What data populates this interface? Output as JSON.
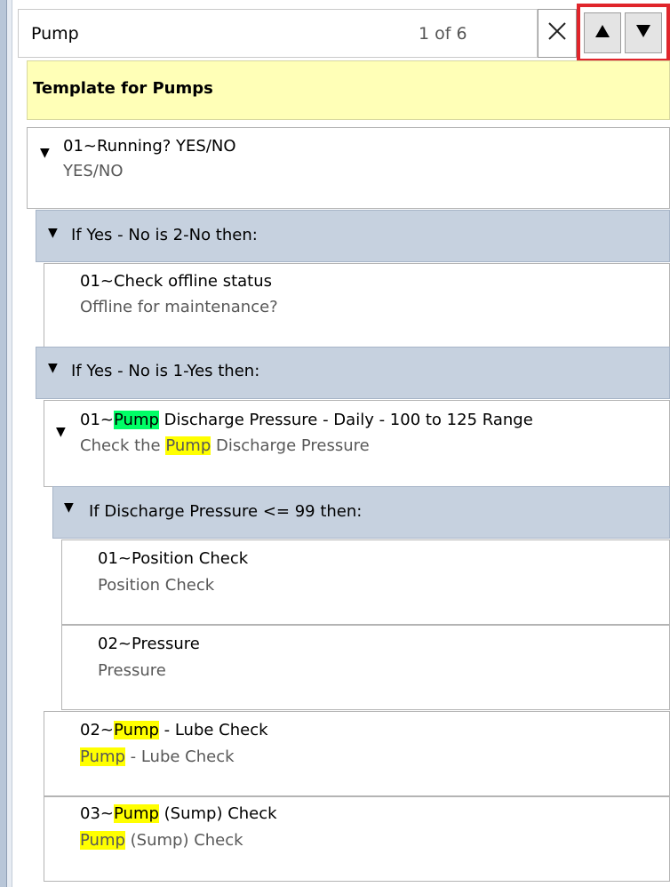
{
  "search": {
    "query": "Pump",
    "match_count": "1 of 6",
    "clear_icon": "close-icon",
    "prev_icon": "triangle-up-icon",
    "next_icon": "triangle-down-icon"
  },
  "template": {
    "title": "Template for Pumps"
  },
  "nodes": {
    "running": {
      "title": "01~Running? YES/NO",
      "subtitle": "YES/NO"
    },
    "cond_no": {
      "label": "If Yes - No is 2-No then:"
    },
    "offline": {
      "title": "01~Check offline status",
      "subtitle": "Offline for maintenance?"
    },
    "cond_yes": {
      "label": "If Yes - No is 1-Yes then:"
    },
    "discharge": {
      "title_prefix": "01~",
      "title_match": "Pump",
      "title_rest": " Discharge Pressure - Daily - 100 to 125 Range",
      "sub_prefix": "Check the ",
      "sub_match": "Pump",
      "sub_rest": " Discharge Pressure"
    },
    "cond_pressure": {
      "label": "If Discharge Pressure <= 99 then:"
    },
    "position": {
      "title": "01~Position Check",
      "subtitle": "Position Check"
    },
    "pressure": {
      "title": "02~Pressure",
      "subtitle": "Pressure"
    },
    "lube": {
      "title_prefix": "02~",
      "title_match": "Pump",
      "title_rest": " - Lube Check",
      "sub_match": "Pump",
      "sub_rest": " - Lube Check"
    },
    "sump": {
      "title_prefix": "03~",
      "title_match": "Pump",
      "title_rest": " (Sump) Check",
      "sub_match": "Pump",
      "sub_rest": " (Sump) Check"
    }
  },
  "colors": {
    "current_match": "#00ff66",
    "other_match": "#ffff00",
    "template_bg": "#ffffb7",
    "condition_bg": "#c6d1df",
    "nav_highlight": "#e0252b"
  }
}
